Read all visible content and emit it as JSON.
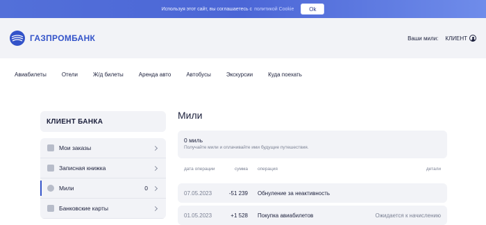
{
  "cookie": {
    "text": "Используя этот сайт, вы соглашаетесь с",
    "link": "политикой Cookie",
    "ok_label": "Ok"
  },
  "header": {
    "brand": "ГАЗПРОМБАНК",
    "miles_label": "Ваши мили:",
    "client_label": "КЛИЕНТ",
    "icons": {
      "logo": "gazprombank-logo",
      "user": "user-icon"
    }
  },
  "nav": {
    "items": [
      {
        "label": "Авиабилеты"
      },
      {
        "label": "Отели"
      },
      {
        "label": "Ж/д билеты"
      },
      {
        "label": "Аренда авто"
      },
      {
        "label": "Автобусы"
      },
      {
        "label": "Экскурсии"
      },
      {
        "label": "Куда поехать"
      }
    ]
  },
  "sidebar": {
    "title": "КЛИЕНТ БАНКА",
    "items": [
      {
        "label": "Мои заказы",
        "icon": "briefcase-icon"
      },
      {
        "label": "Записная книжка",
        "icon": "contact-book-icon"
      },
      {
        "label": "Мили",
        "icon": "miles-icon",
        "count": "0",
        "active": true
      },
      {
        "label": "Банковские карты",
        "icon": "card-icon"
      }
    ]
  },
  "main": {
    "title": "Мили",
    "miles_card": {
      "amount": "0 миль",
      "hint": "Получайте мили и оплачивайте ими будущие путешествия."
    },
    "table": {
      "headers": {
        "date": "дата операции",
        "sum": "сумма",
        "operation": "операция",
        "details": "детали"
      },
      "rows": [
        {
          "date": "07.05.2023",
          "sum": "-51 239",
          "operation": "Обнуление за неактивность",
          "details": ""
        },
        {
          "date": "01.05.2023",
          "sum": "+1 528",
          "operation": "Покупка авиабилетов",
          "details": "Ожидается к начислению"
        }
      ]
    }
  },
  "colors": {
    "brand": "#3353c9",
    "panel": "#f2f3f7",
    "text": "#1b1f3b",
    "muted": "#7a8093"
  }
}
